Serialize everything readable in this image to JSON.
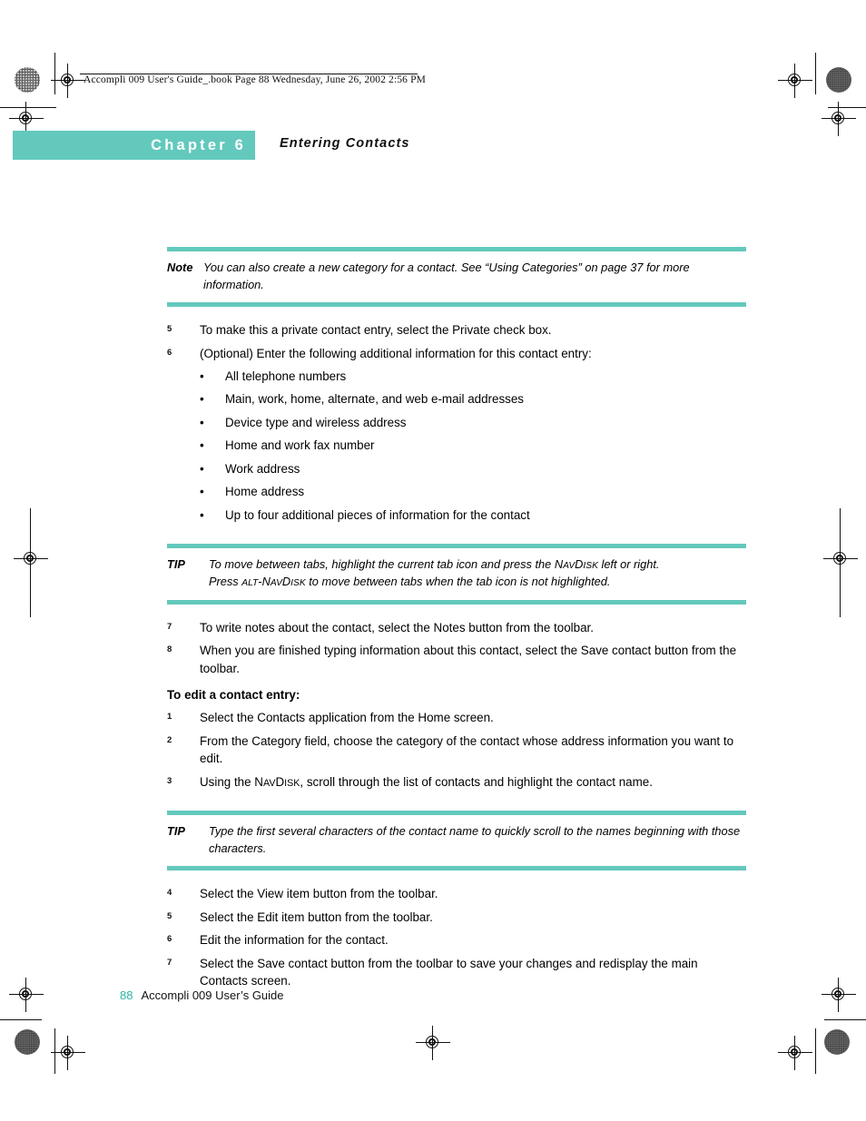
{
  "print_marks": {
    "book_header": "Accompli 009 User's Guide_.book  Page 88  Wednesday, June 26, 2002  2:56 PM"
  },
  "chapter": {
    "banner_label": "Chapter 6",
    "title": "Entering Contacts",
    "banner_color": "#63c9bd"
  },
  "note_callout": {
    "lead": "Note",
    "text": "You can also create a new category for a contact. See “Using Categories” on page 37 for more information."
  },
  "steps_part1": [
    {
      "num": "5",
      "text": "To make this a private contact entry, select the Private check box."
    },
    {
      "num": "6",
      "text": "(Optional) Enter the following additional information for this contact entry:"
    }
  ],
  "bullets": [
    {
      "marker": "•",
      "text": "All telephone numbers"
    },
    {
      "marker": "•",
      "text": "Main, work, home, alternate, and web e-mail addresses"
    },
    {
      "marker": "•",
      "text": "Device type and wireless address"
    },
    {
      "marker": "•",
      "text": "Home and work fax number"
    },
    {
      "marker": "•",
      "text": "Work address"
    },
    {
      "marker": "•",
      "text": "Home address"
    },
    {
      "marker": "•",
      "text": "Up to four additional pieces of information for the contact"
    }
  ],
  "tip_callout_1": {
    "lead": "TIP",
    "line1_pre": "To move between tabs, highlight the current tab icon and press the ",
    "line1_token": "NAVDISK",
    "line1_post": " left or right.",
    "line2_pre": "Press ",
    "line2_token_alt": "ALT",
    "line2_dash": "-",
    "line2_token_nav": "NAVDISK",
    "line2_post": " to move between tabs when the tab icon is not highlighted."
  },
  "steps_part2": [
    {
      "num": "7",
      "text": "To write notes about the contact, select the Notes button from the toolbar."
    },
    {
      "num": "8",
      "text": "When you are finished typing information about this contact, select the Save contact button from the toolbar."
    }
  ],
  "edit_section": {
    "heading": "To edit a contact entry:",
    "steps": [
      {
        "num": "1",
        "text": "Select the Contacts application from the Home screen."
      },
      {
        "num": "2",
        "text": "From the Category field, choose the category of the contact whose address information you want to edit."
      },
      {
        "num": "3",
        "text_pre": "Using the ",
        "token": "NAVDISK",
        "text_post": ", scroll through the list of contacts and highlight the contact name."
      }
    ]
  },
  "tip_callout_2": {
    "lead": "TIP",
    "text": "Type the first several characters of the contact name to quickly scroll to the names beginning with those characters."
  },
  "steps_part3": [
    {
      "num": "4",
      "text": "Select the View item button from the toolbar."
    },
    {
      "num": "5",
      "text": "Select the Edit item button from the toolbar."
    },
    {
      "num": "6",
      "text": "Edit the information for the contact."
    },
    {
      "num": "7",
      "text": "Select the Save contact button from the toolbar to save your changes and redisplay the main Contacts screen."
    }
  ],
  "footer": {
    "page_number": "88",
    "book_title": "Accompli 009 User’s Guide",
    "page_number_color": "#2bb3a3"
  }
}
